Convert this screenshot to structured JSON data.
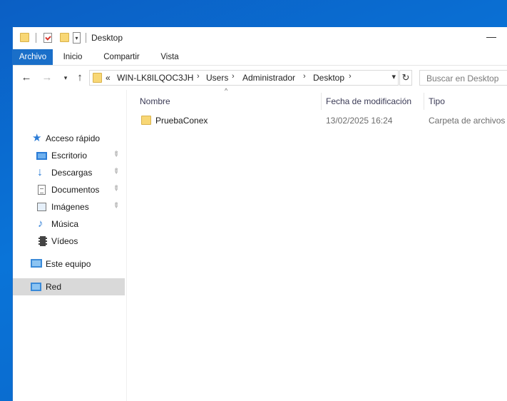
{
  "window": {
    "title": "Desktop",
    "minimize_glyph": "—"
  },
  "ribbon": {
    "tabs": [
      {
        "label": "Archivo",
        "active": true
      },
      {
        "label": "Inicio",
        "active": false
      },
      {
        "label": "Compartir",
        "active": false
      },
      {
        "label": "Vista",
        "active": false
      }
    ]
  },
  "address": {
    "overflow": "«",
    "crumbs": [
      "WIN-LK8ILQOC3JH",
      "Users",
      "Administrador",
      "Desktop"
    ],
    "separator": "›"
  },
  "search": {
    "placeholder": "Buscar en Desktop"
  },
  "navpane": {
    "quick_access": {
      "label": "Acceso rápido",
      "icon": "star-icon"
    },
    "pinned": [
      {
        "label": "Escritorio",
        "icon": "desktop-icon",
        "pinned": true
      },
      {
        "label": "Descargas",
        "icon": "download-icon",
        "pinned": true
      },
      {
        "label": "Documentos",
        "icon": "document-icon",
        "pinned": true
      },
      {
        "label": "Imágenes",
        "icon": "image-icon",
        "pinned": true
      },
      {
        "label": "Música",
        "icon": "music-icon",
        "pinned": false
      },
      {
        "label": "Vídeos",
        "icon": "video-icon",
        "pinned": false
      }
    ],
    "this_pc": {
      "label": "Este equipo",
      "icon": "computer-icon"
    },
    "network": {
      "label": "Red",
      "icon": "network-icon",
      "selected": true
    }
  },
  "columns": {
    "name": "Nombre",
    "date": "Fecha de modificación",
    "type": "Tipo"
  },
  "files": [
    {
      "name": "PruebaConex",
      "date": "13/02/2025 16:24",
      "type": "Carpeta de archivos",
      "icon": "folder-icon"
    }
  ],
  "colors": {
    "accent": "#1a6fc9",
    "selection": "#d9d9d9",
    "desktop": "#0a66c8",
    "folder": "#f8d775"
  }
}
